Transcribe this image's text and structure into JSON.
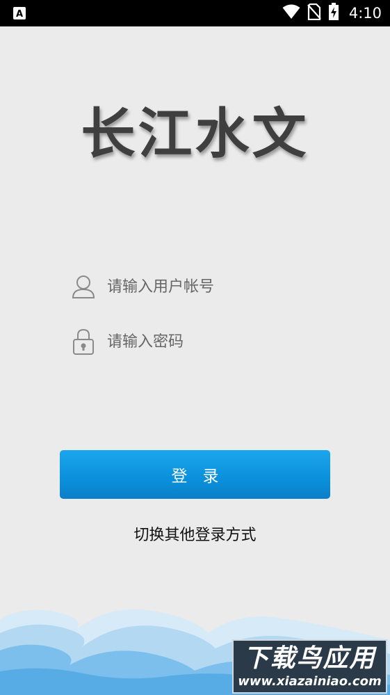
{
  "status_bar": {
    "time": "4:10",
    "left_icon": "a-notification-icon",
    "icons": [
      "wifi-icon",
      "no-sim-icon",
      "battery-charging-icon"
    ]
  },
  "app": {
    "title": "长江水文"
  },
  "form": {
    "username_placeholder": "请输入用户帐号",
    "password_placeholder": "请输入密码",
    "username_icon": "user-icon",
    "password_icon": "lock-icon"
  },
  "actions": {
    "login_label": "登录",
    "switch_label": "切换其他登录方式"
  },
  "watermark": {
    "main": "下载鸟应用",
    "sub": "www.xiazainiao.com"
  },
  "colors": {
    "background": "#ebebeb",
    "button": "#0a90db",
    "wave_light": "#cfe6f6",
    "wave_mid": "#9fcdee",
    "wave_dark": "#5aaee6"
  }
}
